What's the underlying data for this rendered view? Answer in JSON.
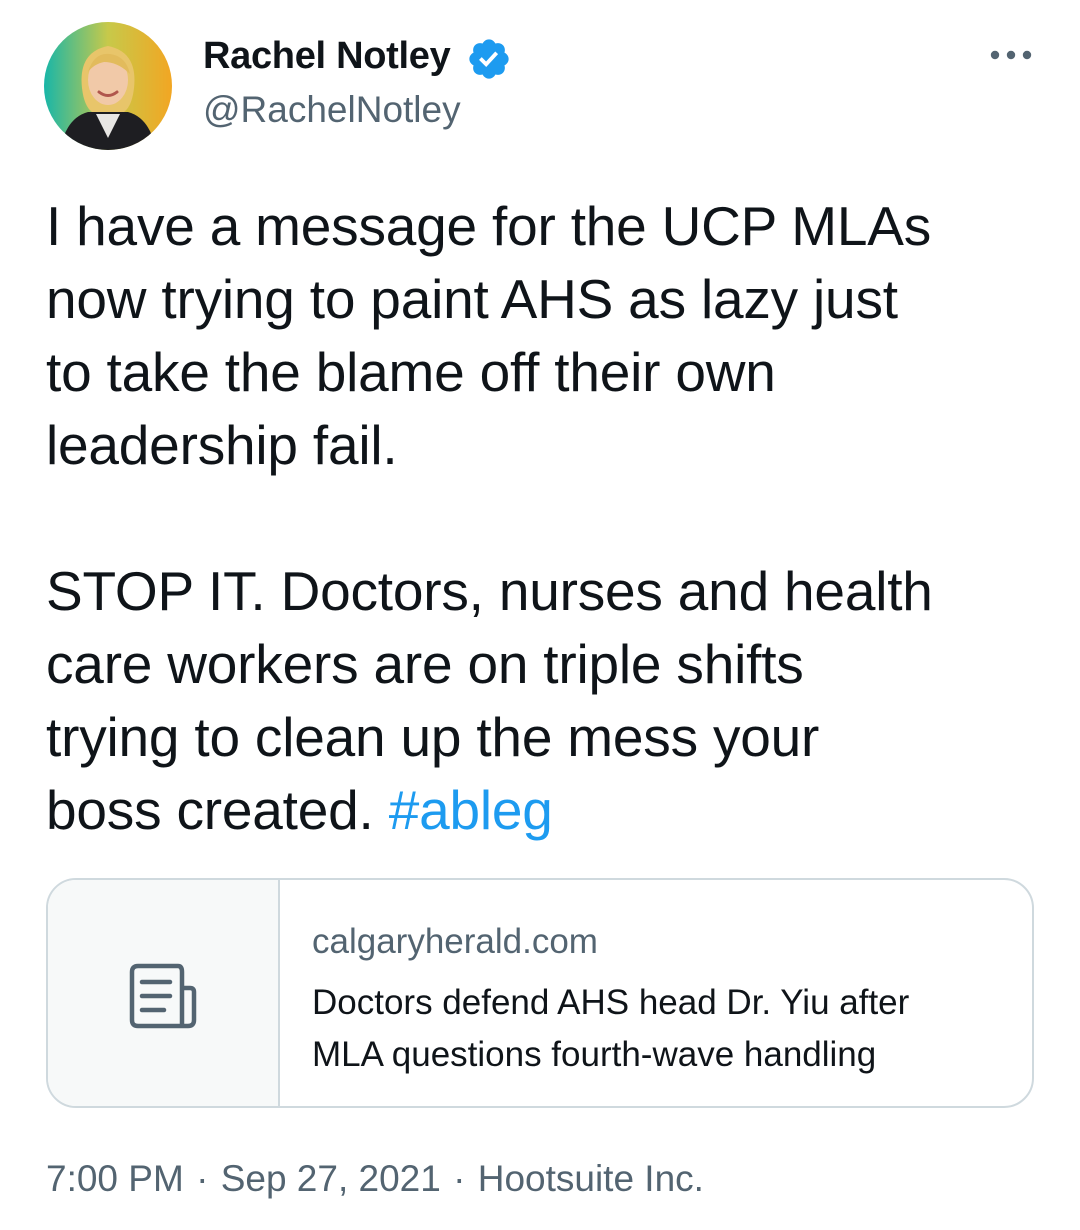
{
  "tweet": {
    "author": {
      "display_name": "Rachel Notley",
      "handle": "@RachelNotley",
      "verified": true
    },
    "text_lines": [
      "I have a message for the UCP MLAs",
      "now trying to paint AHS as lazy just",
      "to take the blame off their own",
      "leadership fail.",
      "STOP IT. Doctors, nurses and health",
      "care workers are on triple shifts",
      "trying to clean up the mess your",
      "boss created."
    ],
    "hashtag": "#ableg",
    "link_card": {
      "domain": "calgaryherald.com",
      "title_lines": [
        "Doctors defend AHS head Dr. Yiu after",
        "MLA questions fourth-wave handling"
      ],
      "thumbnail_icon": "article-icon"
    },
    "meta": {
      "time": "7:00 PM",
      "date": "Sep 27, 2021",
      "source": "Hootsuite Inc.",
      "separator": "·"
    }
  },
  "icons": {
    "verified": "verified-badge-icon",
    "more": "more-options-icon"
  },
  "colors": {
    "text": "#0f1419",
    "secondary": "#536471",
    "link": "#1d9bf0",
    "verified": "#1d9bf0",
    "card_border": "#cfd9de",
    "card_thumb_bg": "#f7f9f9"
  }
}
